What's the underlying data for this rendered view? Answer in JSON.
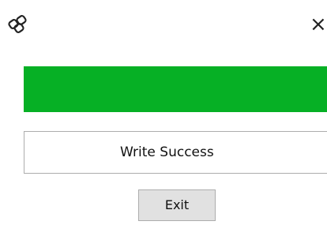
{
  "window": {
    "icon_name": "chain-link-icon",
    "close_glyph": "×"
  },
  "progress": {
    "value": 1.0,
    "color": "#06b025"
  },
  "status": {
    "text": "Write Success"
  },
  "actions": {
    "exit_label": "Exit"
  }
}
